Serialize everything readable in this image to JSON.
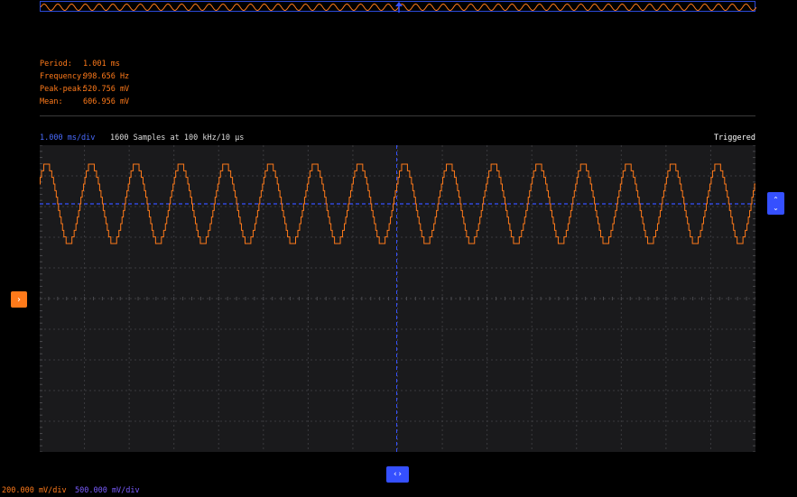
{
  "measurements": {
    "period_label": "Period:",
    "period_value": "1.001 ms",
    "frequency_label": "Frequency:",
    "frequency_value": "998.656 Hz",
    "peakpeak_label": "Peak-peak:",
    "peakpeak_value": "520.756 mV",
    "mean_label": "Mean:",
    "mean_value": "606.956 mV"
  },
  "header": {
    "timebase": "1.000 ms/div",
    "samples": "1600 Samples at 100 kHz/10 µs",
    "status": "Triggered"
  },
  "scales": {
    "channel1": "200.000 mV/div",
    "channel2": "500.000 mV/div"
  },
  "handles": {
    "trigger_up_icon": "chevron-up-icon",
    "trigger_down_icon": "chevron-down-icon",
    "channel_icon": "chevron-right-icon",
    "time_icon": "chevron-left-right-icon"
  },
  "colors": {
    "trace": "#ff7a1a",
    "accent": "#3550ff",
    "grid": "#3a3a3e",
    "plot_bg": "#1a1a1c"
  },
  "chart_data": {
    "type": "line",
    "x_unit": "ms",
    "x_range": [
      0,
      8
    ],
    "frequency_hz": 998.656,
    "peak_to_peak_mv": 520.756,
    "mean_mv": 606.956,
    "cycles_visible": 16,
    "grid": true,
    "trigger_level": "dashed horizontal line",
    "quantized": true
  }
}
